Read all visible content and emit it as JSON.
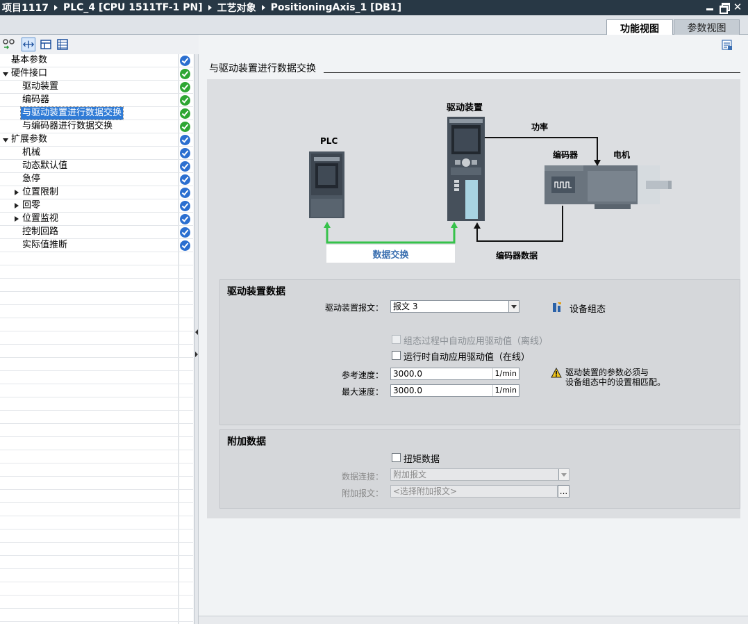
{
  "window": {
    "breadcrumb": [
      "项目1117",
      "PLC_4 [CPU 1511TF-1 PN]",
      "工艺对象",
      "PositioningAxis_1 [DB1]"
    ]
  },
  "tabs": {
    "function_view": "功能视图",
    "parameter_view": "参数视图"
  },
  "nav": {
    "items": [
      {
        "label": "基本参数",
        "level": 0,
        "expand": "none",
        "status": "blue",
        "selected": false
      },
      {
        "label": "硬件接口",
        "level": 0,
        "expand": "expanded",
        "status": "green",
        "selected": false
      },
      {
        "label": "驱动装置",
        "level": 1,
        "expand": "none",
        "status": "green",
        "selected": false
      },
      {
        "label": "编码器",
        "level": 1,
        "expand": "none",
        "status": "green",
        "selected": false
      },
      {
        "label": "与驱动装置进行数据交换",
        "level": 1,
        "expand": "none",
        "status": "green",
        "selected": true
      },
      {
        "label": "与编码器进行数据交换",
        "level": 1,
        "expand": "none",
        "status": "green",
        "selected": false
      },
      {
        "label": "扩展参数",
        "level": 0,
        "expand": "expanded",
        "status": "blue",
        "selected": false
      },
      {
        "label": "机械",
        "level": 1,
        "expand": "none",
        "status": "blue",
        "selected": false
      },
      {
        "label": "动态默认值",
        "level": 1,
        "expand": "none",
        "status": "blue",
        "selected": false
      },
      {
        "label": "急停",
        "level": 1,
        "expand": "none",
        "status": "blue",
        "selected": false
      },
      {
        "label": "位置限制",
        "level": 1,
        "expand": "collapsed",
        "status": "blue",
        "selected": false
      },
      {
        "label": "回零",
        "level": 1,
        "expand": "collapsed",
        "status": "blue",
        "selected": false
      },
      {
        "label": "位置监视",
        "level": 1,
        "expand": "collapsed",
        "status": "blue",
        "selected": false
      },
      {
        "label": "控制回路",
        "level": 1,
        "expand": "none",
        "status": "blue",
        "selected": false
      },
      {
        "label": "实际值推断",
        "level": 1,
        "expand": "none",
        "status": "blue",
        "selected": false
      }
    ]
  },
  "section": {
    "title": "与驱动装置进行数据交换"
  },
  "diagram": {
    "plc": "PLC",
    "drive": "驱动装置",
    "power": "功率",
    "encoder": "编码器",
    "motor": "电机",
    "data_exchange": "数据交换",
    "encoder_data": "编码器数据",
    "colors": {
      "exchange_line": "#36c24a",
      "box": "#dcdee1"
    }
  },
  "drive_data": {
    "heading": "驱动装置数据",
    "telegram_label": "驱动装置报文：",
    "telegram_value": "报文 3",
    "device_config": "设备组态",
    "auto_apply_offline": "组态过程中自动应用驱动值（离线）",
    "auto_apply_online": "运行时自动应用驱动值（在线）",
    "ref_speed_label": "参考速度：",
    "ref_speed_value": "3000.0",
    "ref_speed_unit": "1/min",
    "max_speed_label": "最大速度：",
    "max_speed_value": "3000.0",
    "max_speed_unit": "1/min",
    "warning_line1": "驱动装置的参数必须与",
    "warning_line2": "设备组态中的设置相匹配。"
  },
  "additional_data": {
    "heading": "附加数据",
    "torque_data": "扭矩数据",
    "data_conn_label": "数据连接：",
    "data_conn_value": "附加报文",
    "add_telegram_label": "附加报文：",
    "add_telegram_value": "<选择附加报文>",
    "browse_button": "..."
  }
}
